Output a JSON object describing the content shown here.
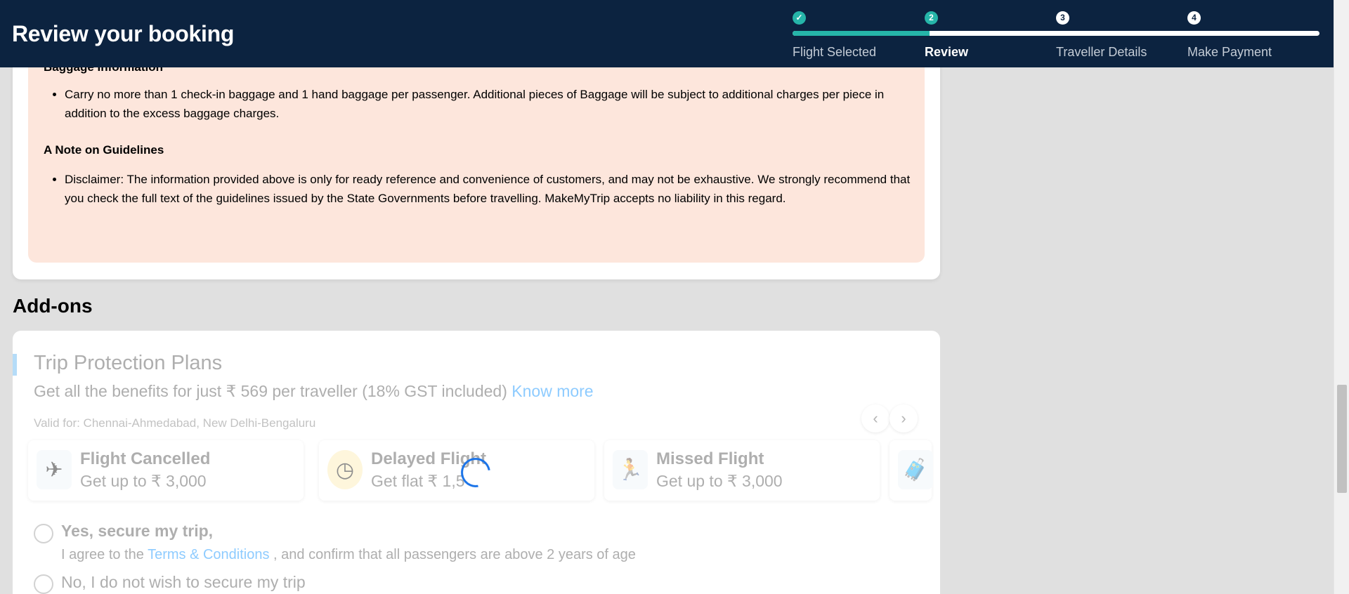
{
  "header": {
    "title": "Review your booking",
    "steps": [
      {
        "number": "✓",
        "label": "Flight Selected",
        "state": "done"
      },
      {
        "number": "2",
        "label": "Review",
        "state": "active"
      },
      {
        "number": "3",
        "label": "Traveller Details",
        "state": "todo"
      },
      {
        "number": "4",
        "label": "Make Payment",
        "state": "todo"
      }
    ],
    "progress_fraction": 0.26
  },
  "info": {
    "baggage_heading": "Baggage Information",
    "baggage_points": [
      "Carry no more than 1 check-in baggage and 1 hand baggage per passenger. Additional pieces of Baggage will be subject to additional charges per piece in addition to the excess baggage charges."
    ],
    "guidelines_heading": "A Note on Guidelines",
    "guidelines_points": [
      "Disclaimer: The information provided above is only for ready reference and convenience of customers, and may not be exhaustive. We strongly recommend that you check the full text of the guidelines issued by the State Governments before travelling. MakeMyTrip accepts no liability in this regard."
    ]
  },
  "addons": {
    "section_title": "Add-ons",
    "trip_protection": {
      "title": "Trip Protection Plans",
      "subtitle_prefix": "Get all the benefits for just ₹ 569 per traveller (18% GST included)",
      "know_more": "Know more",
      "valid_for": "Valid for: Chennai-Ahmedabad, New Delhi-Bengaluru",
      "prev_icon": "chevron-left-icon",
      "next_icon": "chevron-right-icon",
      "benefits": [
        {
          "title": "Flight Cancelled",
          "value": "Get up to ₹ 3,000",
          "icon": "cancelled-plane-icon"
        },
        {
          "title": "Delayed Flight",
          "value": "Get flat ₹ 1,5",
          "icon": "clock-icon"
        },
        {
          "title": "Missed Flight",
          "value": "Get up to ₹ 3,000",
          "icon": "running-traveller-icon"
        }
      ],
      "yes_option": "Yes, secure my trip,",
      "agree_prefix": "I agree to the",
      "terms_link": "Terms & Conditions",
      "agree_suffix": ", and confirm that all passengers are above 2 years of age",
      "no_option": "No, I do not wish to secure my trip"
    }
  },
  "colors": {
    "header_bg": "#0c2340",
    "progress": "#26b5a9",
    "info_bg": "#fde6dc",
    "link": "#008cff"
  }
}
